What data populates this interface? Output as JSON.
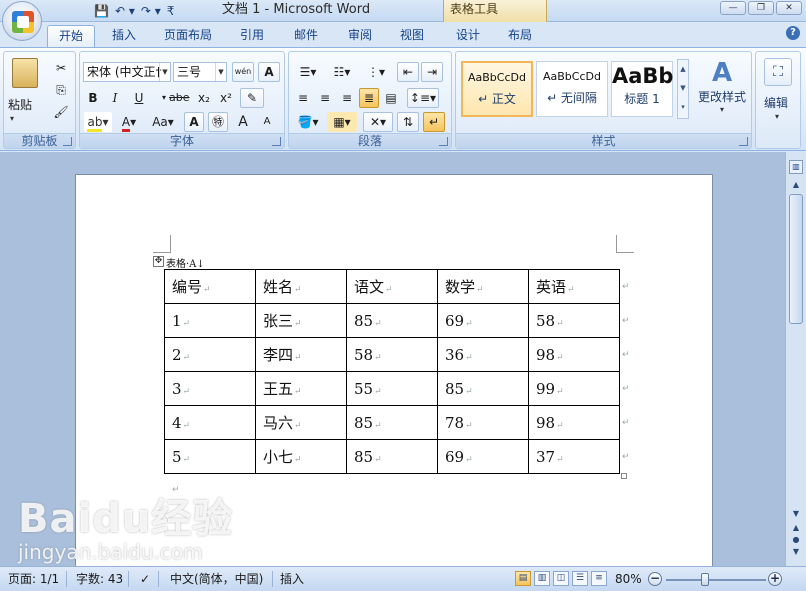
{
  "window": {
    "title": "文档 1 - Microsoft Word",
    "context_tools": "表格工具",
    "controls": [
      "—",
      "❐",
      "✕"
    ]
  },
  "tabs": [
    "开始",
    "插入",
    "页面布局",
    "引用",
    "邮件",
    "审阅",
    "视图",
    "设计",
    "布局"
  ],
  "active_tab": "开始",
  "ribbon": {
    "clipboard": {
      "label": "剪贴板",
      "paste": "粘贴"
    },
    "font": {
      "label": "字体",
      "font_name": "宋体 (中文正†",
      "font_size": "三号",
      "bold": "B",
      "italic": "I",
      "underline": "U",
      "strike": "abe",
      "subscript": "x₂",
      "superscript": "x²",
      "case": "Aa",
      "grow": "A",
      "shrink": "A",
      "phonetic": "wén"
    },
    "paragraph": {
      "label": "段落"
    },
    "styles": {
      "label": "样式",
      "items": [
        {
          "sample": "AaBbCcDd",
          "name": "↵ 正文"
        },
        {
          "sample": "AaBbCcDd",
          "name": "↵ 无间隔"
        },
        {
          "sample": "AaBb",
          "name": "标题 1"
        }
      ],
      "change_styles": "更改样式"
    },
    "editing": {
      "label": "编辑"
    }
  },
  "document": {
    "caption": "表格·A↓",
    "table": {
      "headers": [
        "编号",
        "姓名",
        "语文",
        "数学",
        "英语"
      ],
      "rows": [
        [
          "1",
          "张三",
          "85",
          "69",
          "58"
        ],
        [
          "2",
          "李四",
          "58",
          "36",
          "98"
        ],
        [
          "3",
          "王五",
          "55",
          "85",
          "99"
        ],
        [
          "4",
          "马六",
          "85",
          "78",
          "98"
        ],
        [
          "5",
          "小七",
          "85",
          "69",
          "37"
        ]
      ]
    },
    "mark": "↵"
  },
  "status": {
    "page": "页面: 1/1",
    "words": "字数: 43",
    "language": "中文(简体，中国)",
    "mode": "插入",
    "zoom": "80%"
  },
  "watermark": {
    "line1": "Baidu经验",
    "line2": "jingyan.baidu.com"
  }
}
